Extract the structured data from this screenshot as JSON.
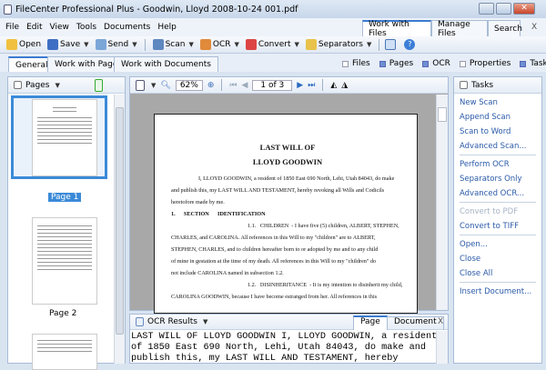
{
  "window": {
    "title": "FileCenter Professional Plus - Goodwin, Lloyd 2008-10-24 001.pdf"
  },
  "menu": [
    "File",
    "Edit",
    "View",
    "Tools",
    "Documents",
    "Help"
  ],
  "top_tabs": [
    "Work with Files",
    "Manage Files",
    "Search"
  ],
  "close_label": "X",
  "toolbar": {
    "open": "Open",
    "save": "Save",
    "send": "Send",
    "scan": "Scan",
    "ocr": "OCR",
    "convert": "Convert",
    "separators": "Separators"
  },
  "sub_tabs": [
    "General",
    "Work with Pages",
    "Work with Documents"
  ],
  "panels_toggles": [
    {
      "label": "Files",
      "on": false
    },
    {
      "label": "Pages",
      "on": true
    },
    {
      "label": "OCR",
      "on": true
    },
    {
      "label": "Properties",
      "on": false
    },
    {
      "label": "Tasks",
      "on": true
    }
  ],
  "pages_panel": {
    "title": "Pages",
    "thumbs": [
      "Page 1",
      "Page 2"
    ]
  },
  "viewer": {
    "zoom": "62%",
    "page": "1 of 3"
  },
  "document": {
    "title1": "LAST WILL OF",
    "title2": "LLOYD GOODWIN",
    "lines": [
      "I, LLOYD GOODWIN, a resident of 1850 East 690 North, Lehi, Utah 84043, do make",
      "and publish this, my LAST WILL AND TESTAMENT, hereby revoking all Wills and Codicils",
      "heretofore made by me.",
      "1.      SECTION      IDENTIFICATION",
      "1.1.   CHILDREN  - I have five (5) children, ALBERT, STEPHEN,",
      "CHARLES, and CAROLINA.  All references in this Will to my \"children\" are to ALBERT,",
      "STEPHEN, CHARLES, and to children hereafter born to or adopted by me and to any child",
      "of mine in gestation at the time of my death.  All references in this Will to my \"children\" do",
      "not include CAROLINA named in subsection 1.2.",
      "1.2.   DISINHERITANCE  - It is my intention to disinherit my child,",
      "CAROLINA GOODWIN, because I have become estranged from her.  All references in this"
    ]
  },
  "ocr": {
    "title": "OCR Results",
    "tabs": [
      "Page",
      "Document"
    ],
    "text": "LAST WILL OF LLOYD GOODWIN I, LLOYD GOODWIN, a resident\nof 1850 East 690 North, Lehi, Utah 84043, do make and\npublish this, my LAST WILL AND TESTAMENT, hereby"
  },
  "tasks": {
    "title": "Tasks",
    "groups": [
      [
        {
          "label": "New Scan"
        },
        {
          "label": "Append Scan"
        },
        {
          "label": "Scan to Word"
        },
        {
          "label": "Advanced Scan..."
        }
      ],
      [
        {
          "label": "Perform OCR"
        },
        {
          "label": "Separators Only"
        },
        {
          "label": "Advanced OCR..."
        }
      ],
      [
        {
          "label": "Convert to PDF",
          "disabled": true
        },
        {
          "label": "Convert to TIFF"
        }
      ],
      [
        {
          "label": "Open..."
        },
        {
          "label": "Close"
        },
        {
          "label": "Close All"
        }
      ],
      [
        {
          "label": "Insert Document..."
        }
      ]
    ]
  }
}
